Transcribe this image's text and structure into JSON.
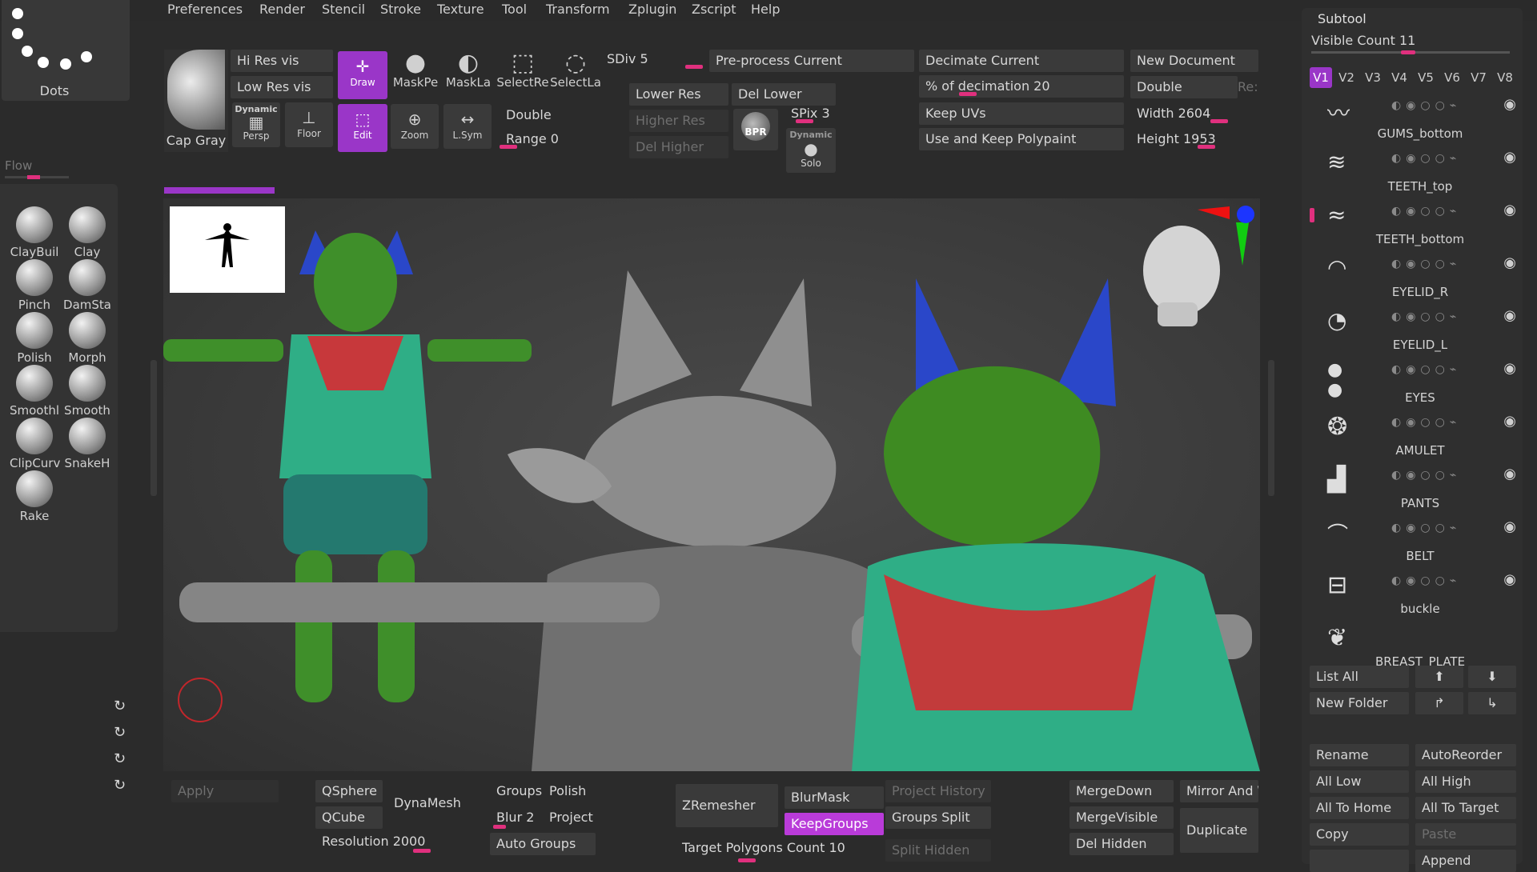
{
  "menu": [
    "Preferences",
    "Render",
    "Stencil",
    "Stroke",
    "Texture",
    "Tool",
    "Transform",
    "Zplugin",
    "Zscript",
    "Help"
  ],
  "stroke_preview": {
    "label": "Dots"
  },
  "material": {
    "label": "Cap Gray"
  },
  "toolbar": {
    "hi_res_vis": "Hi Res vis",
    "low_res_vis": "Low Res vis",
    "draw": "Draw",
    "edit": "Edit",
    "mask_pen": "MaskPe",
    "mask_lasso": "MaskLa",
    "select_rect": "SelectRe",
    "select_lasso": "SelectLa",
    "dynamic": "Dynamic",
    "persp": "Persp",
    "floor": "Floor",
    "zoom": "Zoom",
    "lsym": "L.Sym"
  },
  "subdivision": {
    "sdiv": "SDiv 5",
    "lower_res": "Lower Res",
    "higher_res": "Higher Res",
    "del_lower": "Del Lower",
    "del_higher": "Del Higher",
    "double": "Double",
    "range": "Range 0",
    "preprocess": "Pre-process Current",
    "bpr": "BPR",
    "spix": "SPix 3",
    "dynamic": "Dynamic",
    "solo": "Solo"
  },
  "decimation": {
    "decimate_current": "Decimate Current",
    "percent": "% of decimation 20",
    "keep_uvs": "Keep UVs",
    "keep_polypaint": "Use and Keep Polypaint"
  },
  "document": {
    "new_document": "New Document",
    "double": "Double",
    "res": "Re:",
    "width": "Width 2604",
    "height": "Height 1953"
  },
  "left_panel": {
    "flow": "Flow",
    "brushes": [
      {
        "name": "ClayBuil"
      },
      {
        "name": "Clay"
      },
      {
        "name": "Pinch"
      },
      {
        "name": "DamSta"
      },
      {
        "name": "Polish"
      },
      {
        "name": "Morph"
      },
      {
        "name": "Smoothl"
      },
      {
        "name": "Smooth"
      },
      {
        "name": "ClipCurv"
      },
      {
        "name": "SnakeH"
      },
      {
        "name": "Rake"
      }
    ]
  },
  "subtool": {
    "title": "Subtool",
    "visible_count": "Visible Count 11",
    "versions": [
      "V1",
      "V2",
      "V3",
      "V4",
      "V5",
      "V6",
      "V7",
      "V8"
    ],
    "items": [
      "GUMS_bottom",
      "TEETH_top",
      "TEETH_bottom",
      "EYELID_R",
      "EYELID_L",
      "EYES",
      "AMULET",
      "PANTS",
      "BELT",
      "buckle",
      "BREAST_PLATE"
    ],
    "list_all": "List All",
    "new_folder": "New Folder",
    "rename": "Rename",
    "auto_reorder": "AutoReorder",
    "all_low": "All Low",
    "all_high": "All High",
    "all_to_home": "All To Home",
    "all_to_target": "All To Target",
    "copy": "Copy",
    "paste": "Paste",
    "append": "Append"
  },
  "bottom": {
    "apply": "Apply",
    "qsphere": "QSphere",
    "qcube": "QCube",
    "dynamesh": "DynaMesh",
    "resolution": "Resolution 2000",
    "groups": "Groups",
    "polish": "Polish",
    "blur": "Blur 2",
    "project": "Project",
    "auto_groups": "Auto Groups",
    "zremesher": "ZRemesher",
    "blurmask": "BlurMask",
    "keepgroups": "KeepGroups",
    "target_polygons": "Target Polygons Count 10",
    "project_history": "Project History",
    "groups_split": "Groups Split",
    "split_hidden": "Split Hidden",
    "merge_down": "MergeDown",
    "merge_visible": "MergeVisible",
    "del_hidden": "Del Hidden",
    "mirror_and_weld": "Mirror And W",
    "duplicate": "Duplicate"
  },
  "colors": {
    "accent": "#9a36c8",
    "slider": "#e0307e",
    "panel": "#333333"
  }
}
